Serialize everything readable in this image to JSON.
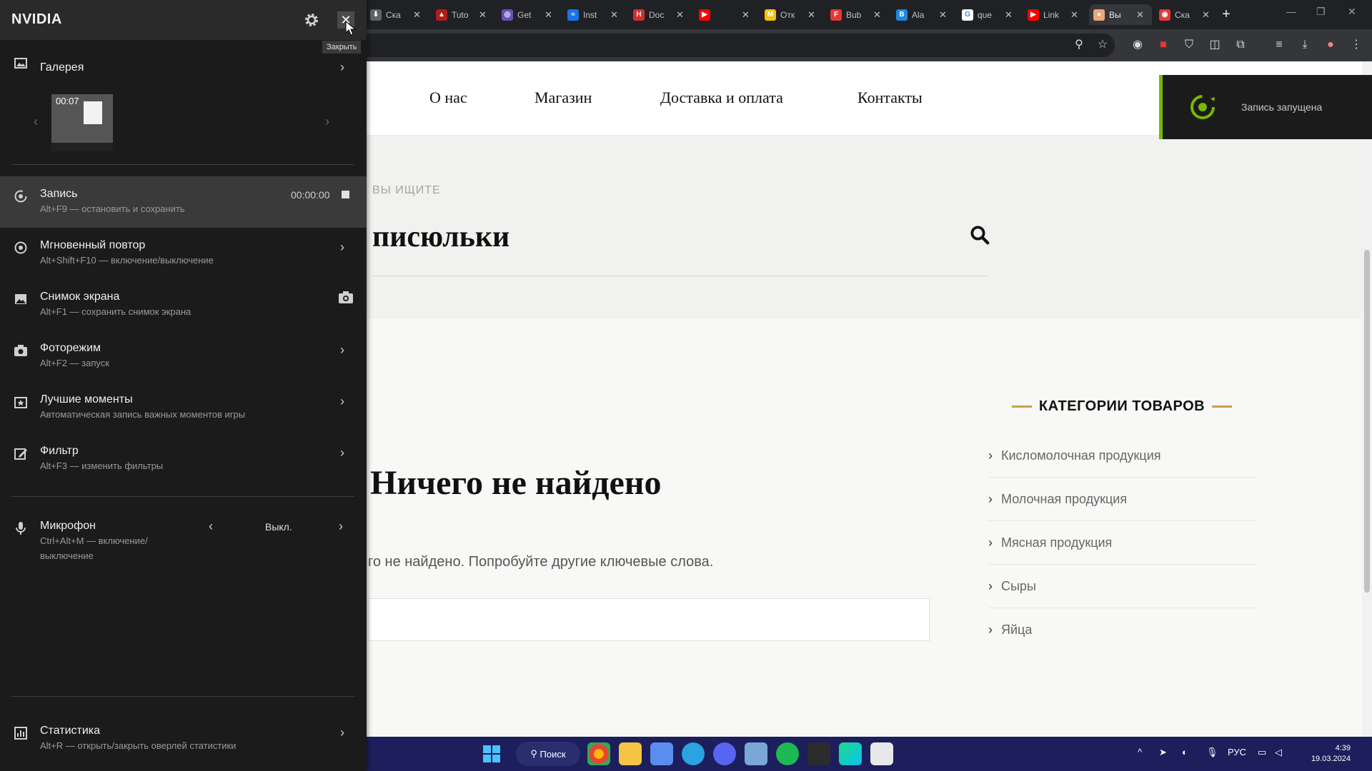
{
  "browser": {
    "tabs": [
      {
        "title": "Ска",
        "color": "#5f6368",
        "glyph": "⬇"
      },
      {
        "title": "Tuto",
        "color": "#b31b1b",
        "glyph": "▲"
      },
      {
        "title": "Get",
        "color": "#6b4fbb",
        "glyph": "◎"
      },
      {
        "title": "Inst",
        "color": "#1a73e8",
        "glyph": "≈"
      },
      {
        "title": "Doc",
        "color": "#d32f2f",
        "glyph": "H"
      },
      {
        "title": "",
        "color": "#ff0000",
        "glyph": "▶"
      },
      {
        "title": "Отк",
        "color": "#f4c20d",
        "glyph": "M"
      },
      {
        "title": "Bub",
        "color": "#e53935",
        "glyph": "F"
      },
      {
        "title": "Ala",
        "color": "#1e88e5",
        "glyph": "B"
      },
      {
        "title": "que",
        "color": "#ffffff",
        "glyph": "G"
      },
      {
        "title": "Link",
        "color": "#ff0000",
        "glyph": "▶"
      },
      {
        "title": "Вы",
        "color": "#e8a87c",
        "glyph": "●"
      },
      {
        "title": "Ска",
        "color": "#e53935",
        "glyph": "◉"
      }
    ],
    "new_tab": "+"
  },
  "site": {
    "nav": [
      "О нас",
      "Магазин",
      "Доставка и оплата",
      "Контакты"
    ],
    "search_label": "ВЫ ИЩИТЕ",
    "search_query": "писюльки",
    "nothing_title": "Ничего не найдено",
    "nothing_text": "го не найдено. Попробуйте другие ключевые слова.",
    "categories_title": "КАТЕГОРИИ ТОВАРОВ",
    "categories": [
      "Кисломолочная продукция",
      "Молочная продукция",
      "Мясная продукция",
      "Сыры",
      "Яйца"
    ],
    "accent_color": "#c9a04b"
  },
  "recording_toast": {
    "text": "Запись запущена",
    "accent": "#76b900"
  },
  "nvidia": {
    "logo": "NVIDIA",
    "close_tooltip": "Закрыть",
    "gallery": {
      "label": "Галерея",
      "thumb_time": "00:07"
    },
    "record": {
      "label": "Запись",
      "hint": "Alt+F9 — остановить и сохранить",
      "time": "00:00:00"
    },
    "instant_replay": {
      "label": "Мгновенный повтор",
      "hint": "Alt+Shift+F10 — включение/выключение"
    },
    "screenshot": {
      "label": "Снимок экрана",
      "hint": "Alt+F1 — сохранить снимок экрана"
    },
    "photo_mode": {
      "label": "Фоторежим",
      "hint": "Alt+F2 — запуск"
    },
    "highlights": {
      "label": "Лучшие моменты",
      "hint": "Автоматическая запись важных моментов игры"
    },
    "filter": {
      "label": "Фильтр",
      "hint": "Alt+F3 — изменить фильтры"
    },
    "microphone": {
      "label": "Микрофон",
      "hint_line1": "Ctrl+Alt+M — включение/",
      "hint_line2": "выключение",
      "value": "Выкл."
    },
    "stats": {
      "label": "Статистика",
      "hint": "Alt+R — открыть/закрыть оверлей статистики"
    }
  },
  "taskbar": {
    "search": "Поиск",
    "lang": "РУС",
    "time": "4:39",
    "date": "19.03.2024"
  }
}
